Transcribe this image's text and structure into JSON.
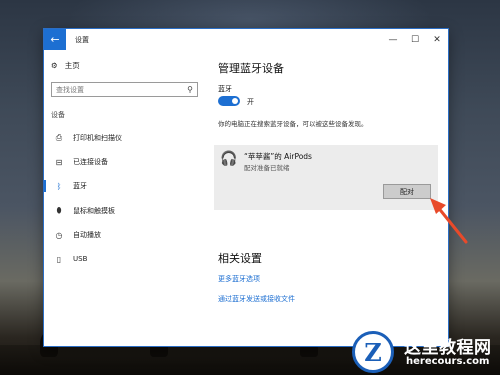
{
  "window": {
    "title": "设置",
    "controls": {
      "minimize_icon": "minimize-icon",
      "maximize_icon": "maximize-icon",
      "close_icon": "close-icon"
    }
  },
  "sidebar": {
    "home_label": "主页",
    "search_placeholder": "查找设置",
    "section_label": "设备",
    "items": [
      {
        "label": "打印机和扫描仪",
        "icon": "printer-icon"
      },
      {
        "label": "已连接设备",
        "icon": "connected-devices-icon"
      },
      {
        "label": "蓝牙",
        "icon": "bluetooth-icon",
        "active": true
      },
      {
        "label": "鼠标和触摸板",
        "icon": "mouse-icon"
      },
      {
        "label": "自动播放",
        "icon": "autoplay-icon"
      },
      {
        "label": "USB",
        "icon": "usb-icon"
      }
    ]
  },
  "main": {
    "title": "管理蓝牙设备",
    "bluetooth_label": "蓝牙",
    "toggle_state": "开",
    "scan_text": "你的电脑正在搜索蓝牙设备，可以被这些设备发现。",
    "device": {
      "name": "“苹苹酱”的 AirPods",
      "status": "配对准备已就绪",
      "pair_button": "配对",
      "icon": "headphones-icon"
    },
    "related_title": "相关设置",
    "links": [
      "更多蓝牙选项",
      "通过蓝牙发送或接收文件"
    ]
  },
  "watermark": {
    "text": "这里教程网",
    "url": "herecours.com"
  },
  "colors": {
    "accent": "#1d6fd2",
    "arrow": "#e84a2a"
  }
}
